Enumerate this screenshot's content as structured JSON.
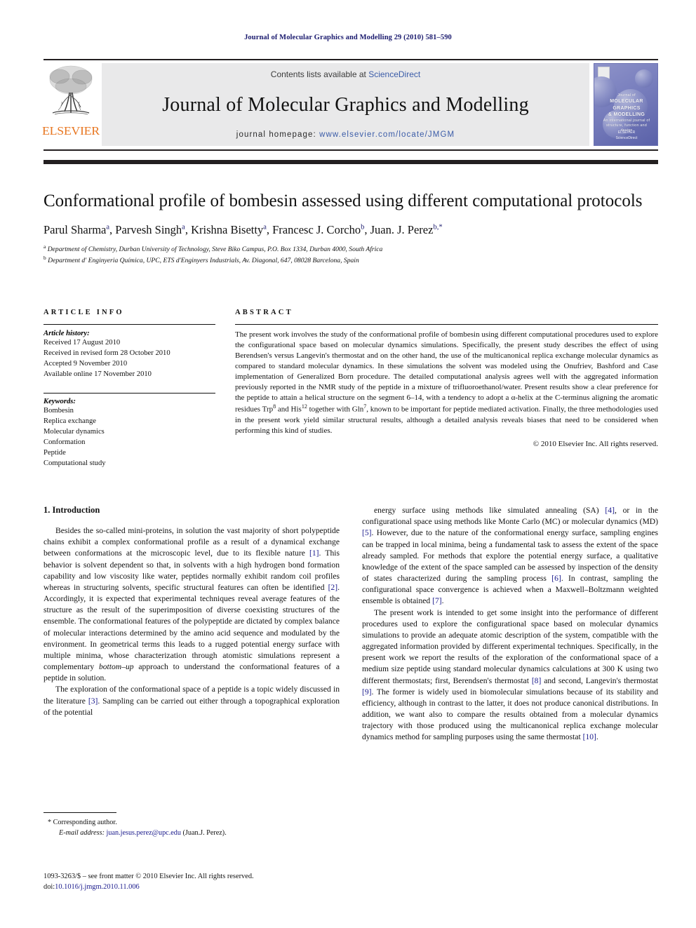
{
  "running_head": "Journal of Molecular Graphics and Modelling 29 (2010) 581–590",
  "masthead": {
    "publisher": "ELSEVIER",
    "contents_prefix": "Contents lists available at ",
    "contents_link": "ScienceDirect",
    "journal_title": "Journal of Molecular Graphics and Modelling",
    "homepage_prefix": "journal homepage: ",
    "homepage_url": "www.elsevier.com/locate/JMGM",
    "cover": {
      "line1": "Journal of",
      "line2": "MOLECULAR GRAPHICS",
      "line3": "& MODELLING",
      "line4": "An international journal of structure, function and design",
      "foot1": "ELSEVIER",
      "foot2": "ScienceDirect"
    }
  },
  "article": {
    "title": "Conformational profile of bombesin assessed using different computational protocols",
    "authors_html": "Parul Sharma<sup>a</sup>, Parvesh Singh<sup>a</sup>, Krishna Bisetty<sup>a</sup>, Francesc J. Corcho<sup>b</sup>, Juan. J. Perez<sup>b,</sup><sup>*</sup>",
    "affiliation_a": "Department of Chemistry, Durban University of Technology, Steve Biko Campus, P.O. Box 1334, Durban 4000, South Africa",
    "affiliation_b": "Department d' Enginyeria Química, UPC, ETS d'Enginyers Industrials, Av. Diagonal, 647, 08028 Barcelona, Spain"
  },
  "article_info": {
    "heading": "ARTICLE INFO",
    "history_label": "Article history:",
    "history": [
      "Received 17 August 2010",
      "Received in revised form 28 October 2010",
      "Accepted 9 November 2010",
      "Available online 17 November 2010"
    ],
    "keywords_label": "Keywords:",
    "keywords": [
      "Bombesin",
      "Replica exchange",
      "Molecular dynamics",
      "Conformation",
      "Peptide",
      "Computational study"
    ]
  },
  "abstract": {
    "heading": "ABSTRACT",
    "body_html": "The present work involves the study of the conformational profile of bombesin using different computational procedures used to explore the configurational space based on molecular dynamics simulations. Specifically, the present study describes the effect of using Berendsen's versus Langevin's thermostat and on the other hand, the use of the multicanonical replica exchange molecular dynamics as compared to standard molecular dynamics. In these simulations the solvent was modeled using the Onufriev, Bashford and Case implementation of Generalized Born procedure. The detailed computational analysis agrees well with the aggregated information previously reported in the NMR study of the peptide in a mixture of trifluoroethanol/water. Present results show a clear preference for the peptide to attain a helical structure on the segment 6&ndash;14, with a tendency to adopt a &alpha;-helix at the C-terminus aligning the aromatic residues Trp<sup>8</sup> and His<sup>12</sup> together with Gln<sup>7</sup>, known to be important for peptide mediated activation. Finally, the three methodologies used in the present work yield similar structural results, although a detailed analysis reveals biases that need to be considered when performing this kind of studies.",
    "copyright": "© 2010 Elsevier Inc. All rights reserved."
  },
  "section": {
    "number_title": "1.  Introduction",
    "left_paragraphs_html": [
      "Besides the so-called mini-proteins, in solution the vast majority of short polypeptide chains exhibit a complex conformational profile as a result of a dynamical exchange between conformations at the microscopic level, due to its flexible nature <span class=\"ref\">[1]</span>. This behavior is solvent dependent so that, in solvents with a high hydrogen bond formation capability and low viscosity like water, peptides normally exhibit random coil profiles whereas in structuring solvents, specific structural features can often be identified <span class=\"ref\">[2]</span>. Accordingly, it is expected that experimental techniques reveal average features of the structure as the result of the superimposition of diverse coexisting structures of the ensemble. The conformational features of the polypeptide are dictated by complex balance of molecular interactions determined by the amino acid sequence and modulated by the environment. In geometrical terms this leads to a rugged potential energy surface with multiple minima, whose characterization through atomistic simulations represent a complementary <span class=\"ital\">bottom&ndash;up</span> approach to understand the conformational features of a peptide in solution.",
      "The exploration of the conformational space of a peptide is a topic widely discussed in the literature <span class=\"ref\">[3]</span>. Sampling can be carried out either through a topographical exploration of the potential"
    ],
    "right_paragraphs_html": [
      "energy surface using methods like simulated annealing (SA) <span class=\"ref\">[4]</span>, or in the configurational space using methods like Monte Carlo (MC) or molecular dynamics (MD) <span class=\"ref\">[5]</span>. However, due to the nature of the conformational energy surface, sampling engines can be trapped in local minima, being a fundamental task to assess the extent of the space already sampled. For methods that explore the potential energy surface, a qualitative knowledge of the extent of the space sampled can be assessed by inspection of the density of states characterized during the sampling process <span class=\"ref\">[6]</span>. In contrast, sampling the configurational space convergence is achieved when a Maxwell&ndash;Boltzmann weighted ensemble is obtained <span class=\"ref\">[7]</span>.",
      "The present work is intended to get some insight into the performance of different procedures used to explore the configurational space based on molecular dynamics simulations to provide an adequate atomic description of the system, compatible with the aggregated information provided by different experimental techniques. Specifically, in the present work we report the results of the exploration of the conformational space of a medium size peptide using standard molecular dynamics calculations at 300 K using two different thermostats; first, Berendsen's thermostat <span class=\"ref\">[8]</span> and second, Langevin's thermostat <span class=\"ref\">[9]</span>. The former is widely used in biomolecular simulations because of its stability and efficiency, although in contrast to the latter, it does not produce canonical distributions. In addition, we want also to compare the results obtained from a molecular dynamics trajectory with those produced using the multicanonical replica exchange molecular dynamics method for sampling purposes using the same thermostat <span class=\"ref\">[10]</span>."
    ]
  },
  "footnote": {
    "corresponding_marker": "*",
    "corresponding_text": "Corresponding author.",
    "email_label": "E-mail address:",
    "email": "juan.jesus.perez@upc.edu",
    "email_person": "(Juan.J. Perez)."
  },
  "imprint": {
    "line1_html": "1093-3263/$ &ndash; see front matter © 2010 Elsevier Inc. All rights reserved.",
    "doi_label": "doi:",
    "doi": "10.1016/j.jmgm.2010.11.006"
  },
  "colors": {
    "link_blue": "#1a1a8c",
    "sciencedirect_blue": "#3b5ca8",
    "elsevier_orange": "#e87722",
    "masthead_gray": "#e9e9ea"
  }
}
